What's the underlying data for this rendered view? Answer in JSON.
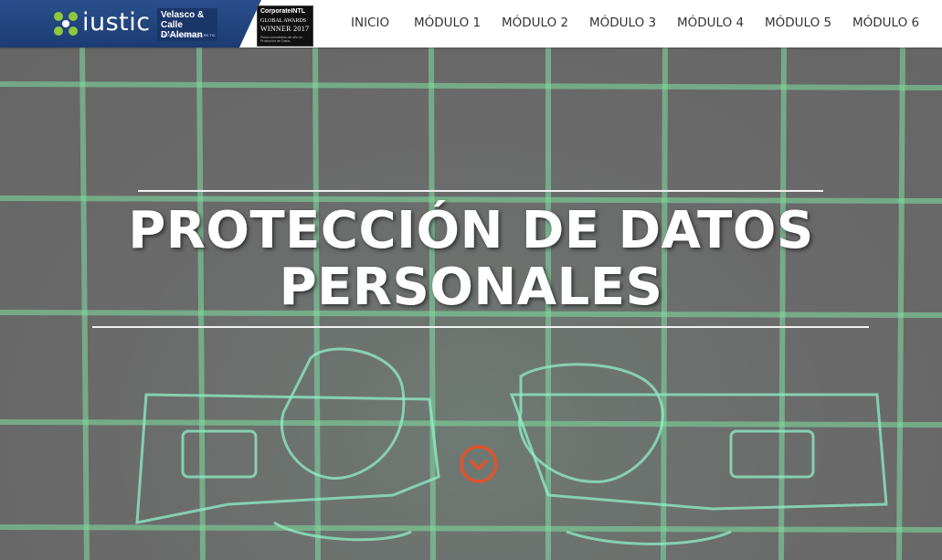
{
  "header": {
    "logo_text": "iustic",
    "partner": {
      "name": "Velasco & Calle D'Aleman",
      "tagline": "ABOGADOS EXPERTOS EN TIC"
    },
    "award": {
      "line1": "CorporateINTL",
      "line2": "GLOBAL AWARDS",
      "line3": "WINNER 2017",
      "line4": "Firma colombiana del año en Protección de Datos"
    },
    "nav": [
      "INICIO",
      "MÓDULO 1",
      "MÓDULO 2",
      "MÓDULO 3",
      "MÓDULO 4",
      "MÓDULO 5",
      "MÓDULO 6"
    ]
  },
  "hero": {
    "title_line1": "PROTECCIÓN DE DATOS",
    "title_line2": "PERSONALES",
    "scroll_icon": "chevron-down-circle-icon"
  },
  "colors": {
    "brand_blue": "#1c3c72",
    "grid_green": "#7fe0a0",
    "accent_orange": "#e0532a",
    "hero_gray": "#6b6b6b"
  }
}
